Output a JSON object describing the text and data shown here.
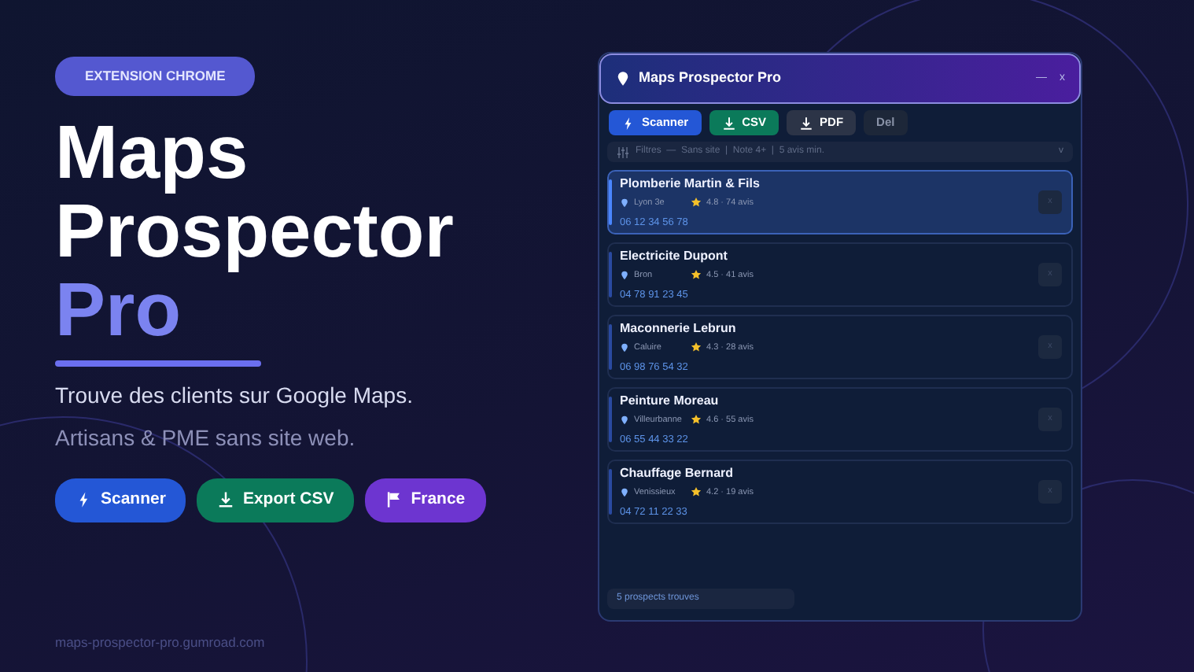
{
  "hero": {
    "badge": "EXTENSION CHROME",
    "title_lines": [
      {
        "text": "Maps",
        "accent": false
      },
      {
        "text": "Prospector",
        "accent": false
      },
      {
        "text": "Pro",
        "accent": true
      }
    ],
    "subtitle": "Trouve des clients sur Google Maps.",
    "tagline": "Artisans & PME sans site web.",
    "buttons": [
      {
        "label": "Scanner",
        "kind": "scan",
        "color": "#2457d6"
      },
      {
        "label": "Export CSV",
        "kind": "download",
        "color": "#0b7a5a"
      },
      {
        "label": "France",
        "kind": "flag",
        "color": "#6d35d0"
      }
    ],
    "url": "maps-prospector-pro.gumroad.com"
  },
  "panel": {
    "title": "Maps Prospector Pro",
    "window_controls": [
      "—",
      "x"
    ],
    "toolbar": [
      {
        "label": "Scanner",
        "kind": "scan",
        "color": "#2457d6"
      },
      {
        "label": "CSV",
        "kind": "download",
        "color": "#0b7a5a"
      },
      {
        "label": "PDF",
        "kind": "download",
        "color": "#2c3447"
      },
      {
        "label": "Del",
        "kind": "plain",
        "color": "#1d2739"
      }
    ],
    "filter": {
      "text": "Filtres  —  Sans site  |  Note 4+  |  5 avis min.",
      "toggle": "v"
    },
    "results": [
      {
        "name": "Plomberie Martin & Fils",
        "city": "Lyon 3e",
        "rating": "4.8 · 74 avis",
        "phone": "06 12 34 56 78",
        "close": "x",
        "selected": true
      },
      {
        "name": "Electricite Dupont",
        "city": "Bron",
        "rating": "4.5 · 41 avis",
        "phone": "04 78 91 23 45",
        "close": "x",
        "selected": false
      },
      {
        "name": "Maconnerie Lebrun",
        "city": "Caluire",
        "rating": "4.3 · 28 avis",
        "phone": "06 98 76 54 32",
        "close": "x",
        "selected": false
      },
      {
        "name": "Peinture Moreau",
        "city": "Villeurbanne",
        "rating": "4.6 · 55 avis",
        "phone": "06 55 44 33 22",
        "close": "x",
        "selected": false
      },
      {
        "name": "Chauffage Bernard",
        "city": "Venissieux",
        "rating": "4.2 · 19 avis",
        "phone": "04 72 11 22 33",
        "close": "x",
        "selected": false
      }
    ],
    "status": "5 prospects trouves"
  }
}
